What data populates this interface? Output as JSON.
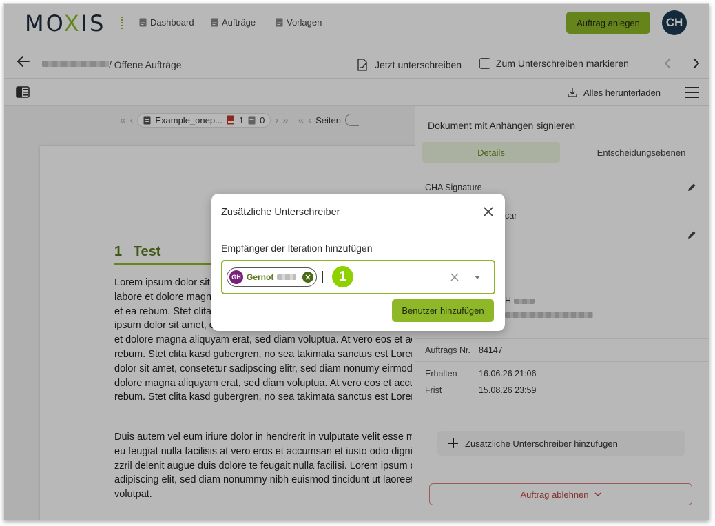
{
  "app": {
    "logo": {
      "left": "MO",
      "x": "X",
      "right": "IS"
    },
    "nav": [
      {
        "label": "Dashboard",
        "icon": "document-icon"
      },
      {
        "label": "Aufträge",
        "icon": "document-icon"
      },
      {
        "label": "Vorlagen",
        "icon": "document-icon"
      }
    ],
    "create_order_label": "Auftrag anlegen",
    "user_initials": "CH"
  },
  "breadcrumb": {
    "suffix": "/ Offene Aufträge"
  },
  "actions": {
    "sign_now": "Jetzt unterschreiben",
    "mark_for_signing": "Zum Unterschreiben markieren",
    "download_all": "Alles herunterladen"
  },
  "doc_toolbar": {
    "filename": "Example_onep...",
    "pdf_count": "1",
    "attachment_count": "0",
    "pages_label": "Seiten"
  },
  "document": {
    "heading_number": "1",
    "heading_text": "Test",
    "lines": [
      "Lorem ipsum dolor sit amet, consetetur sadipscing elitr, sed diam nonumy eirmod tempor invidunt ut",
      "labore et dolore magna aliquyam erat, sed diam voluptua. At vero eos et accusam et justo duo dolores",
      "et ea rebum. Stet clita kasd gubergren, no sea takimata sanctus est Lorem ipsum dolor sit amet. Lorem",
      "ipsum dolor sit amet, consetetur sadipscing elitr, sed diam nonumy eirmod tempor invidunt ut labore",
      "et dolore magna aliquyam erat, sed diam voluptua. At vero eos et accusam et justo duo dolores et ea",
      "rebum. Stet clita kasd gubergren, no sea takimata sanctus est Lorem ipsum dolor sit amet. Lorem ipsum",
      "dolor sit amet, consetetur sadipscing elitr, sed diam nonumy eirmod tempor invidunt ut labore et",
      "dolore magna aliquyam erat, sed diam voluptua. At vero eos et accusam et justo duo dolores et ea",
      "rebum. Stet clita kasd gubergren, no sea takimata sanctus est Lorem ipsum dolor sit amet."
    ],
    "lines2": [
      "Duis autem vel eum iriure dolor in hendrerit in vulputate velit esse molestie consequat, vel illum dolore",
      "eu feugiat nulla facilisis at vero eros et accumsan et iusto odio dignissim qui blandit praesent luptatum",
      "zzril delenit augue duis dolore te feugait nulla facilisi. Lorem ipsum dolor sit amet, consectetuer",
      "adipiscing elit, sed diam nonummy nibh euismod tincidunt ut laoreet dolore magna aliquam erat",
      "volutpat."
    ]
  },
  "side_panel": {
    "title": "Dokument mit Anhängen signieren",
    "tabs": [
      "Details",
      "Entscheidungsebenen"
    ],
    "signature_label": "CHA Signature",
    "partial_label": "car",
    "partial_name": "H",
    "order_no_label": "Auftrags Nr.",
    "order_no": "84147",
    "received_label": "Erhalten",
    "received": "16.06.26 21:06",
    "deadline_label": "Frist",
    "deadline": "15.08.26 23:59",
    "add_signers": "Zusätzliche Unterschreiber hinzufügen",
    "reject": "Auftrag ablehnen"
  },
  "modal": {
    "title": "Zusätzliche Unterschreiber",
    "field_label": "Empfänger der Iteration hinzufügen",
    "chip": {
      "initials": "GH",
      "name": "Gernot"
    },
    "marker": "1",
    "add_user_label": "Benutzer hinzufügen"
  },
  "colors": {
    "accent": "#8eb828",
    "brand_dark": "#1d3a52",
    "reject": "#b5443e"
  }
}
